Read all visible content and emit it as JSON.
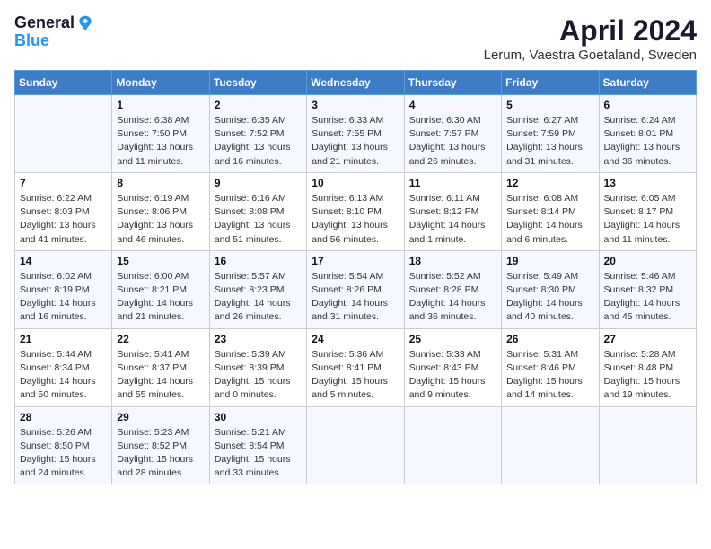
{
  "header": {
    "logo_line1": "General",
    "logo_line2": "Blue",
    "month": "April 2024",
    "location": "Lerum, Vaestra Goetaland, Sweden"
  },
  "days_of_week": [
    "Sunday",
    "Monday",
    "Tuesday",
    "Wednesday",
    "Thursday",
    "Friday",
    "Saturday"
  ],
  "weeks": [
    [
      {
        "day": "",
        "sunrise": "",
        "sunset": "",
        "daylight": ""
      },
      {
        "day": "1",
        "sunrise": "6:38 AM",
        "sunset": "7:50 PM",
        "daylight": "13 hours and 11 minutes."
      },
      {
        "day": "2",
        "sunrise": "6:35 AM",
        "sunset": "7:52 PM",
        "daylight": "13 hours and 16 minutes."
      },
      {
        "day": "3",
        "sunrise": "6:33 AM",
        "sunset": "7:55 PM",
        "daylight": "13 hours and 21 minutes."
      },
      {
        "day": "4",
        "sunrise": "6:30 AM",
        "sunset": "7:57 PM",
        "daylight": "13 hours and 26 minutes."
      },
      {
        "day": "5",
        "sunrise": "6:27 AM",
        "sunset": "7:59 PM",
        "daylight": "13 hours and 31 minutes."
      },
      {
        "day": "6",
        "sunrise": "6:24 AM",
        "sunset": "8:01 PM",
        "daylight": "13 hours and 36 minutes."
      }
    ],
    [
      {
        "day": "7",
        "sunrise": "6:22 AM",
        "sunset": "8:03 PM",
        "daylight": "13 hours and 41 minutes."
      },
      {
        "day": "8",
        "sunrise": "6:19 AM",
        "sunset": "8:06 PM",
        "daylight": "13 hours and 46 minutes."
      },
      {
        "day": "9",
        "sunrise": "6:16 AM",
        "sunset": "8:08 PM",
        "daylight": "13 hours and 51 minutes."
      },
      {
        "day": "10",
        "sunrise": "6:13 AM",
        "sunset": "8:10 PM",
        "daylight": "13 hours and 56 minutes."
      },
      {
        "day": "11",
        "sunrise": "6:11 AM",
        "sunset": "8:12 PM",
        "daylight": "14 hours and 1 minute."
      },
      {
        "day": "12",
        "sunrise": "6:08 AM",
        "sunset": "8:14 PM",
        "daylight": "14 hours and 6 minutes."
      },
      {
        "day": "13",
        "sunrise": "6:05 AM",
        "sunset": "8:17 PM",
        "daylight": "14 hours and 11 minutes."
      }
    ],
    [
      {
        "day": "14",
        "sunrise": "6:02 AM",
        "sunset": "8:19 PM",
        "daylight": "14 hours and 16 minutes."
      },
      {
        "day": "15",
        "sunrise": "6:00 AM",
        "sunset": "8:21 PM",
        "daylight": "14 hours and 21 minutes."
      },
      {
        "day": "16",
        "sunrise": "5:57 AM",
        "sunset": "8:23 PM",
        "daylight": "14 hours and 26 minutes."
      },
      {
        "day": "17",
        "sunrise": "5:54 AM",
        "sunset": "8:26 PM",
        "daylight": "14 hours and 31 minutes."
      },
      {
        "day": "18",
        "sunrise": "5:52 AM",
        "sunset": "8:28 PM",
        "daylight": "14 hours and 36 minutes."
      },
      {
        "day": "19",
        "sunrise": "5:49 AM",
        "sunset": "8:30 PM",
        "daylight": "14 hours and 40 minutes."
      },
      {
        "day": "20",
        "sunrise": "5:46 AM",
        "sunset": "8:32 PM",
        "daylight": "14 hours and 45 minutes."
      }
    ],
    [
      {
        "day": "21",
        "sunrise": "5:44 AM",
        "sunset": "8:34 PM",
        "daylight": "14 hours and 50 minutes."
      },
      {
        "day": "22",
        "sunrise": "5:41 AM",
        "sunset": "8:37 PM",
        "daylight": "14 hours and 55 minutes."
      },
      {
        "day": "23",
        "sunrise": "5:39 AM",
        "sunset": "8:39 PM",
        "daylight": "15 hours and 0 minutes."
      },
      {
        "day": "24",
        "sunrise": "5:36 AM",
        "sunset": "8:41 PM",
        "daylight": "15 hours and 5 minutes."
      },
      {
        "day": "25",
        "sunrise": "5:33 AM",
        "sunset": "8:43 PM",
        "daylight": "15 hours and 9 minutes."
      },
      {
        "day": "26",
        "sunrise": "5:31 AM",
        "sunset": "8:46 PM",
        "daylight": "15 hours and 14 minutes."
      },
      {
        "day": "27",
        "sunrise": "5:28 AM",
        "sunset": "8:48 PM",
        "daylight": "15 hours and 19 minutes."
      }
    ],
    [
      {
        "day": "28",
        "sunrise": "5:26 AM",
        "sunset": "8:50 PM",
        "daylight": "15 hours and 24 minutes."
      },
      {
        "day": "29",
        "sunrise": "5:23 AM",
        "sunset": "8:52 PM",
        "daylight": "15 hours and 28 minutes."
      },
      {
        "day": "30",
        "sunrise": "5:21 AM",
        "sunset": "8:54 PM",
        "daylight": "15 hours and 33 minutes."
      },
      {
        "day": "",
        "sunrise": "",
        "sunset": "",
        "daylight": ""
      },
      {
        "day": "",
        "sunrise": "",
        "sunset": "",
        "daylight": ""
      },
      {
        "day": "",
        "sunrise": "",
        "sunset": "",
        "daylight": ""
      },
      {
        "day": "",
        "sunrise": "",
        "sunset": "",
        "daylight": ""
      }
    ]
  ],
  "labels": {
    "sunrise_prefix": "Sunrise: ",
    "sunset_prefix": "Sunset: ",
    "daylight_prefix": "Daylight: "
  }
}
